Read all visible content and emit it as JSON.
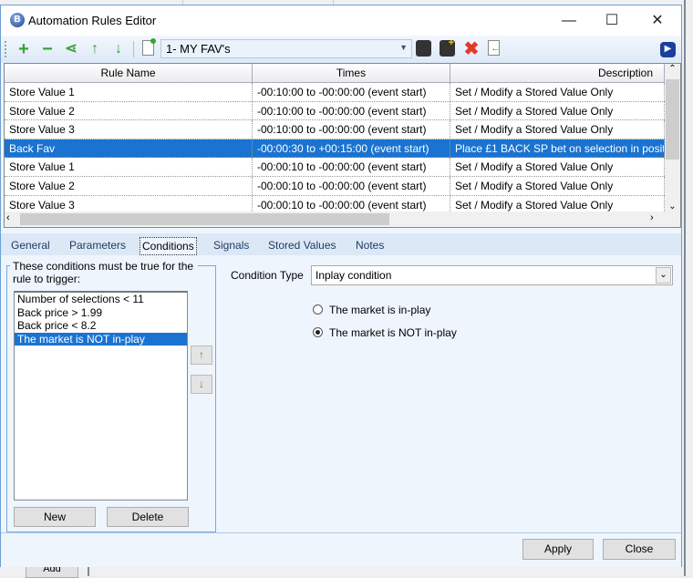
{
  "background": {
    "add_button": "Add"
  },
  "window": {
    "title": "Automation Rules Editor",
    "logo_letter": "B"
  },
  "toolbar": {
    "ruleset": "1- MY FAV's"
  },
  "grid": {
    "columns": [
      "Rule Name",
      "Times",
      "Description"
    ],
    "rows": [
      [
        "Store Value 1",
        "-00:10:00 to -00:00:00 (event start)",
        "Set / Modify a Stored Value Only"
      ],
      [
        "Store Value 2",
        "-00:10:00 to -00:00:00 (event start)",
        "Set / Modify a Stored Value Only"
      ],
      [
        "Store Value 3",
        "-00:10:00 to -00:00:00 (event start)",
        "Set / Modify a Stored Value Only"
      ],
      [
        "Back Fav",
        "-00:00:30 to +00:15:00 (event start)",
        "Place £1 BACK SP bet on selection in posit"
      ],
      [
        "Store Value 1",
        "-00:00:10 to -00:00:00 (event start)",
        "Set / Modify a Stored Value Only"
      ],
      [
        "Store Value 2",
        "-00:00:10 to -00:00:00 (event start)",
        "Set / Modify a Stored Value Only"
      ],
      [
        "Store Value 3",
        "-00:00:10 to -00:00:00 (event start)",
        "Set / Modify a Stored Value Only"
      ]
    ],
    "selected_row": 3
  },
  "tabs": [
    "General",
    "Parameters",
    "Conditions",
    "Signals",
    "Stored Values",
    "Notes"
  ],
  "active_tab": "Conditions",
  "conditions": {
    "group_label": "These conditions must be true for the rule to trigger:",
    "items": [
      "Number of selections < 11",
      "Back price > 1.99",
      "Back price < 8.2",
      "The market is NOT in-play"
    ],
    "selected_item": 3,
    "new_label": "New",
    "delete_label": "Delete",
    "condition_type_label": "Condition Type",
    "condition_type_value": "Inplay condition",
    "radio_options": [
      "The market is in-play",
      "The market is NOT in-play"
    ],
    "radio_selected": 1
  },
  "footer": {
    "apply": "Apply",
    "close": "Close"
  },
  "colors": {
    "selection": "#1a73d0",
    "panel": "#eef5fd",
    "icon_green": "#3aa13a",
    "delete_red": "#e03a2a"
  }
}
